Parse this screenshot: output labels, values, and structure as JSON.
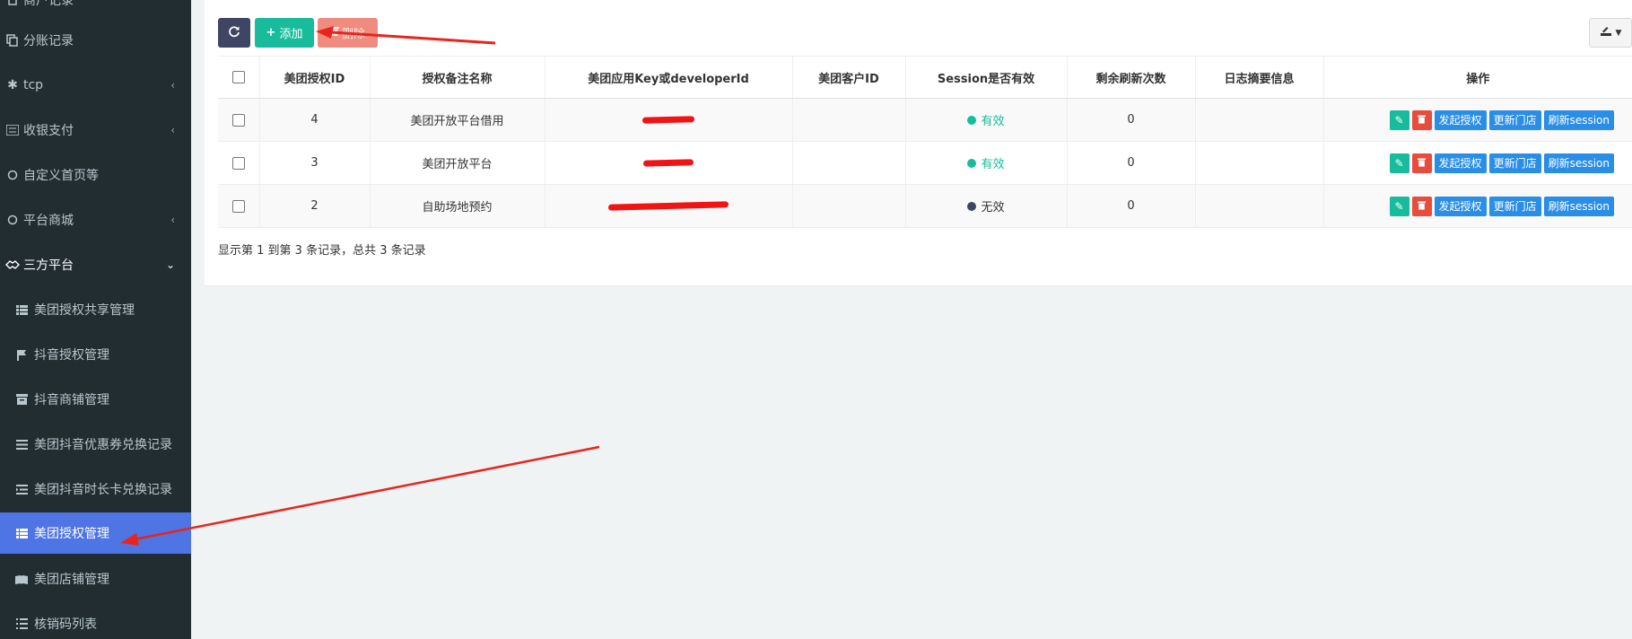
{
  "sidebar": {
    "items": [
      {
        "label": "商户记录",
        "icon": "file-icon"
      },
      {
        "label": "分账记录",
        "icon": "copy-icon"
      },
      {
        "label": "tcp",
        "icon": "asterisk-icon",
        "caret": "‹"
      },
      {
        "label": "收银支付",
        "icon": "list-icon",
        "caret": "‹"
      },
      {
        "label": "自定义首页等",
        "icon": "circle-icon"
      },
      {
        "label": "平台商城",
        "icon": "circle-icon",
        "caret": "‹"
      },
      {
        "label": "三方平台",
        "icon": "handshake-icon",
        "caret": "⌄"
      },
      {
        "label": "美团授权共享管理",
        "icon": "list-icon"
      },
      {
        "label": "抖音授权管理",
        "icon": "flag-icon"
      },
      {
        "label": "抖音商铺管理",
        "icon": "archive-icon"
      },
      {
        "label": "美团抖音优惠券兑换记录",
        "icon": "align-icon"
      },
      {
        "label": "美团抖音时长卡兑换记录",
        "icon": "indent-icon"
      },
      {
        "label": "美团授权管理",
        "icon": "list-icon"
      },
      {
        "label": "美团店铺管理",
        "icon": "book-icon"
      },
      {
        "label": "核销码列表",
        "icon": "list-ol-icon"
      }
    ]
  },
  "toolbar": {
    "refresh_icon": "refresh-icon",
    "add_label": "添加",
    "delete_label": "删除",
    "export_icon": "export-icon"
  },
  "table": {
    "columns": [
      "美团授权ID",
      "授权备注名称",
      "美团应用Key或developerId",
      "美团客户ID",
      "Session是否有效",
      "剩余刷新次数",
      "日志摘要信息",
      "操作"
    ],
    "rows": [
      {
        "id": "4",
        "name": "美团开放平台借用",
        "key": "",
        "customer_id": "",
        "status": "有效",
        "refresh_count": "0",
        "log": ""
      },
      {
        "id": "3",
        "name": "美团开放平台",
        "key": "",
        "customer_id": "",
        "status": "有效",
        "refresh_count": "0",
        "log": ""
      },
      {
        "id": "2",
        "name": "自助场地预约",
        "key": "",
        "customer_id": "",
        "status": "无效",
        "refresh_count": "0",
        "log": ""
      }
    ],
    "row_actions": {
      "authorize": "发起授权",
      "update_store": "更新门店",
      "refresh_session": "刷新session"
    }
  },
  "summary": "显示第 1 到第 3 条记录，总共 3 条记录",
  "colors": {
    "sidebar_bg": "#222d32",
    "active_item": "#4f74e3",
    "valid": "#18bc9c",
    "invalid": "#3e4663",
    "annotation_arrow": "#e8251c"
  }
}
